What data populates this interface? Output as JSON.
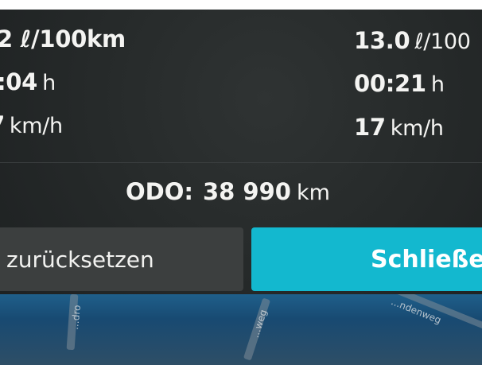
{
  "trip": {
    "left": {
      "consumption": "2 ℓ/100km",
      "duration_value": ":04",
      "duration_unit": "h",
      "speed_value": "7",
      "speed_unit": "km/h"
    },
    "right": {
      "consumption_value": "13.0",
      "consumption_unit": "ℓ/100",
      "duration_value": "00:21",
      "duration_unit": "h",
      "speed_value": "17",
      "speed_unit": "km/h"
    }
  },
  "odometer": {
    "label": "ODO:",
    "value": "38 990",
    "unit": "km"
  },
  "buttons": {
    "reset_label": "zurücksetzen",
    "close_label": "Schließen"
  },
  "map": {
    "street_labels": [
      "...dro",
      "...weg",
      "...ndenweg"
    ]
  },
  "colors": {
    "close_button": "#13b8cf",
    "reset_button": "#3c3f3f",
    "screen_background": "#262a2a",
    "map_water": "#1f5f8a"
  }
}
